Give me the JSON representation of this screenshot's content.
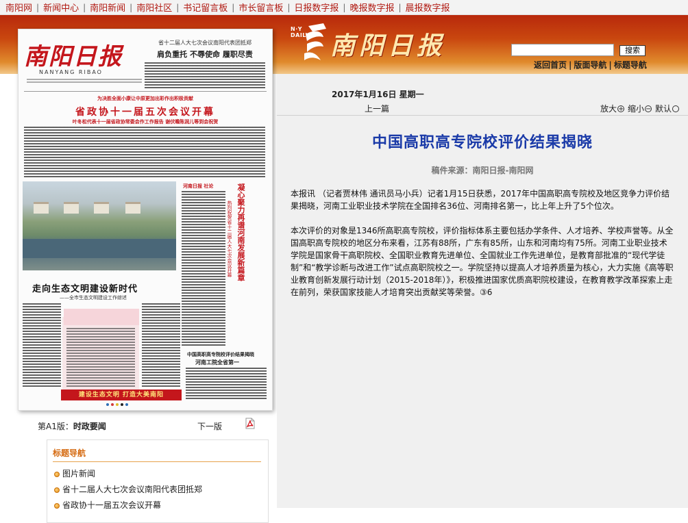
{
  "topnav": {
    "links": [
      "南阳网",
      "新闻中心",
      "南阳新闻",
      "南阳社区",
      "书记留言板",
      "市长留言板",
      "日报数字报",
      "晚报数字报",
      "晨报数字报"
    ]
  },
  "header": {
    "logo_small": "N·Y DAILY",
    "logo_text": "南阳日报",
    "search_placeholder": "",
    "search_button": "搜索",
    "links": [
      "返回首页",
      "版面导航",
      "标题导航"
    ],
    "colors": {
      "band_top": "#b8290c",
      "band_bottom": "#f2c88a"
    }
  },
  "paper_preview": {
    "masthead": "南阳日报",
    "masthead_pinyin": "NANYANG   RIBAO",
    "header_right_line1": "省十二届人大七次会议南阳代表团抵郑",
    "header_right_line2": "肩负重托  不辱使命  履职尽责",
    "tagline": "为决胜全面小康让中原更加出彩作出积极贡献",
    "headline": "省政协十一届五次会议开幕",
    "sub_headline": "叶冬松代表十一届省政协常委会作工作报告  谢伏瞻陈润儿等到会祝贺",
    "side_brand": "河南日报 社论",
    "side_title": "凝心聚力再谱河南发展新篇章",
    "side_sub": "热烈祝贺省十二届人大七次会议开幕",
    "mid_title": "走向生态文明建设新时代",
    "mid_sub": "——全市生态文明建设工作综述",
    "rb_title1": "中国高职高专院校评价结果揭晓",
    "rb_title2": "河南工院全省第一",
    "banner": "建设生态文明  打造大美南阳"
  },
  "edition": {
    "label": "第A1版：",
    "name": "时政要闻",
    "next": "下一版",
    "pdf_icon": "pdf-icon"
  },
  "nav_box": {
    "title": "标题导航",
    "items": [
      "图片新闻",
      "省十二届人大七次会议南阳代表团抵郑",
      "省政协十一届五次会议开幕"
    ]
  },
  "article": {
    "date": "2017年1月16日 星期一",
    "prev": "上一篇",
    "zoom_in": "放大",
    "zoom_out": "缩小",
    "zoom_default": "默认",
    "title": "中国高职高专院校评价结果揭晓",
    "source": "稿件来源：南阳日报-南阳网",
    "paragraphs": [
      "本报讯 （记者贾林伟 通讯员马小兵）记者1月15日获悉，2017年中国高职高专院校及地区竞争力评价结果揭晓，河南工业职业技术学院在全国排名36位、河南排名第一，比上年上升了5个位次。",
      "本次评价的对象是1346所高职高专院校，评价指标体系主要包括办学条件、人才培养、学校声誉等。从全国高职高专院校的地区分布来看，江苏有88所，广东有85所，山东和河南均有75所。河南工业职业技术学院是国家骨干高职院校、全国职业教育先进单位、全国就业工作先进单位，是教育部批准的“现代学徒制”和“教学诊断与改进工作”试点高职院校之一。学院坚持以提高人才培养质量为核心，大力实施《高等职业教育创新发展行动计划（2015-2018年）》，积极推进国家优质高职院校建设，在教育教学改革探索上走在前列，荣获国家技能人才培育突出贡献奖等荣誉。③6"
    ],
    "title_color": "#1a3aa8"
  }
}
